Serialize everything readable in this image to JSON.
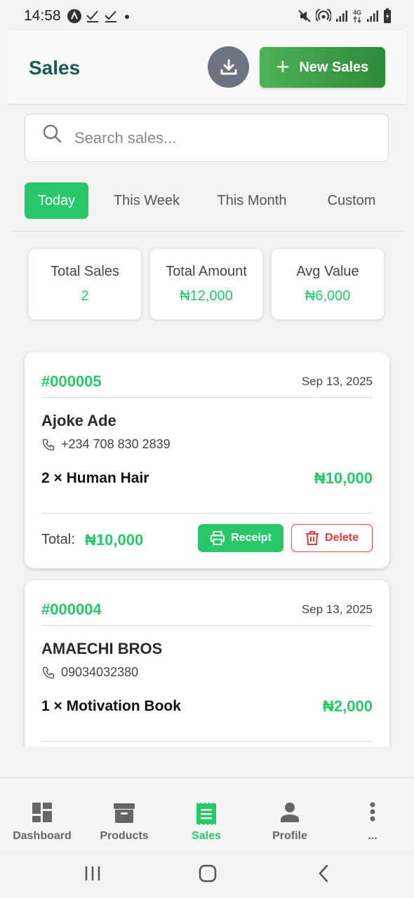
{
  "status_bar": {
    "time": "14:58",
    "network_label": "4G",
    "left_icons": [
      "notification-a-icon",
      "check-icon",
      "check-icon",
      "dot-icon"
    ],
    "right_icons": [
      "mute-icon",
      "hotspot-icon",
      "signal-icon",
      "signal-4g-icon",
      "battery-icon"
    ]
  },
  "header": {
    "title": "Sales",
    "download_icon": "download-icon",
    "new_sales_label": "New Sales"
  },
  "search": {
    "placeholder": "Search sales...",
    "value": ""
  },
  "tabs": [
    {
      "label": "Today",
      "active": true
    },
    {
      "label": "This Week",
      "active": false
    },
    {
      "label": "This Month",
      "active": false
    },
    {
      "label": "Custom",
      "active": false
    }
  ],
  "stats": [
    {
      "label": "Total Sales",
      "value": "2"
    },
    {
      "label": "Total Amount",
      "value": "₦12,000"
    },
    {
      "label": "Avg Value",
      "value": "₦6,000"
    }
  ],
  "sales": [
    {
      "id": "#000005",
      "date": "Sep 13, 2025",
      "customer": "Ajoke Ade",
      "phone": "+234 708 830 2839",
      "item": "2 × Human Hair",
      "item_amount": "₦10,000",
      "total_label": "Total:",
      "total": "₦10,000",
      "receipt_label": "Receipt",
      "delete_label": "Delete"
    },
    {
      "id": "#000004",
      "date": "Sep 13, 2025",
      "customer": "AMAECHI BROS",
      "phone": "09034032380",
      "item": "1 × Motivation Book",
      "item_amount": "₦2,000"
    }
  ],
  "bottom_nav": [
    {
      "label": "Dashboard",
      "icon": "dashboard-icon",
      "active": false
    },
    {
      "label": "Products",
      "icon": "archive-box-icon",
      "active": false
    },
    {
      "label": "Sales",
      "icon": "receipt-icon",
      "active": true
    },
    {
      "label": "Profile",
      "icon": "person-icon",
      "active": false
    },
    {
      "label": "...",
      "icon": "more-vertical-icon",
      "active": false
    }
  ],
  "colors": {
    "accent_green": "#28c76a",
    "title_teal": "#135c4f",
    "danger_red": "#e03c3c",
    "download_gray": "#6b7480"
  }
}
